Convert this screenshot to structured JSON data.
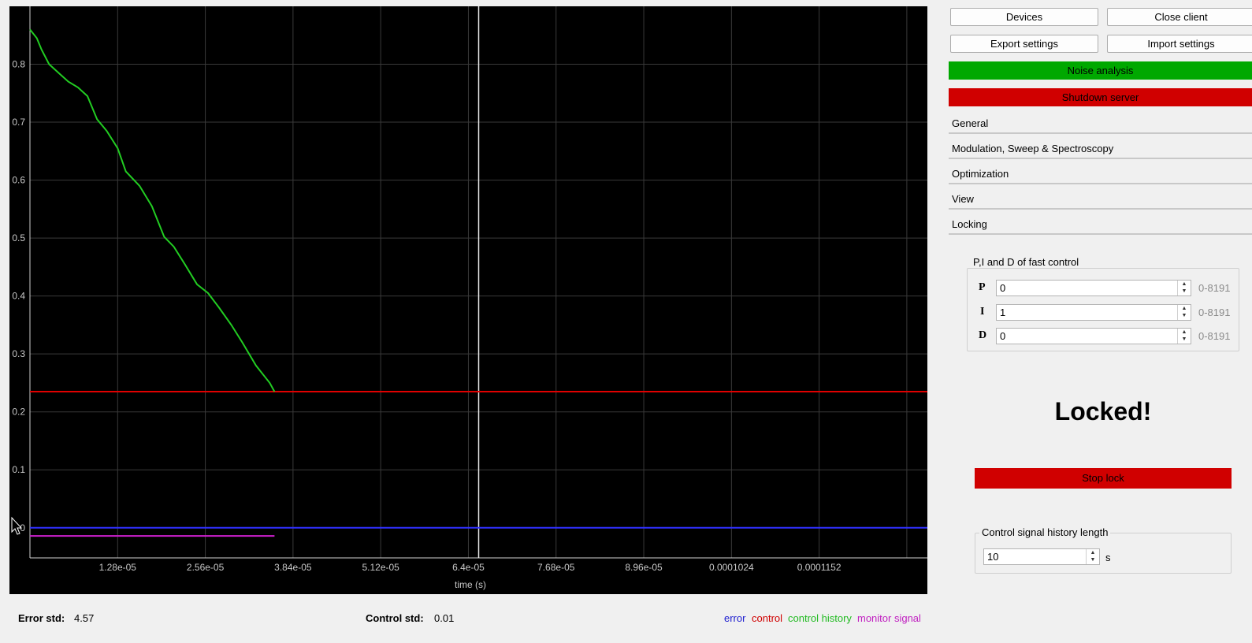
{
  "chart_data": {
    "type": "line",
    "xlabel": "time (s)",
    "x_ticks": [
      1.28e-05,
      2.56e-05,
      3.84e-05,
      5.12e-05,
      6.4e-05,
      7.68e-05,
      8.96e-05,
      0.0001024,
      0.0001152
    ],
    "x_tick_labels": [
      "1.28e-05",
      "2.56e-05",
      "3.84e-05",
      "5.12e-05",
      "6.4e-05",
      "7.68e-05",
      "8.96e-05",
      "0.0001024",
      "0.0001152"
    ],
    "xlim": [
      0,
      0.000131
    ],
    "y_ticks": [
      0,
      0.1,
      0.2,
      0.3,
      0.4,
      0.5,
      0.6,
      0.7,
      0.8
    ],
    "y_tick_labels": [
      "0",
      "0.1",
      "0.2",
      "0.3",
      "0.4",
      "0.5",
      "0.6",
      "0.7",
      "0.8"
    ],
    "ylim": [
      -0.052,
      0.9
    ],
    "grid": true,
    "cursor_x": 6.55e-05,
    "series": [
      {
        "name": "error",
        "color": "#3030ff",
        "x": [
          0,
          0.000131
        ],
        "y": [
          0.0,
          0.0
        ]
      },
      {
        "name": "control",
        "color": "#e00000",
        "x": [
          0,
          0.000131
        ],
        "y": [
          0.235,
          0.235
        ]
      },
      {
        "name": "control history",
        "color": "#22cc22",
        "x": [
          0,
          1e-06,
          1.7e-06,
          2.8e-06,
          4.2e-06,
          5.6e-06,
          7e-06,
          8.4e-06,
          9.8e-06,
          1.12e-05,
          1.28e-05,
          1.4e-05,
          1.6e-05,
          1.78e-05,
          1.96e-05,
          2.1e-05,
          2.26e-05,
          2.44e-05,
          2.6e-05,
          2.76e-05,
          2.94e-05,
          3.1e-05,
          3.3e-05,
          3.5e-05,
          3.57e-05
        ],
        "y": [
          0.86,
          0.845,
          0.825,
          0.8,
          0.785,
          0.77,
          0.76,
          0.745,
          0.705,
          0.685,
          0.655,
          0.615,
          0.59,
          0.555,
          0.502,
          0.485,
          0.455,
          0.42,
          0.405,
          0.38,
          0.35,
          0.32,
          0.28,
          0.25,
          0.235
        ]
      },
      {
        "name": "monitor signal",
        "color": "#d020d0",
        "x": [
          0,
          3.57e-05
        ],
        "y": [
          -0.014,
          -0.014
        ]
      }
    ]
  },
  "toolbar": {
    "devices": "Devices",
    "close_client": "Close client",
    "export_settings": "Export settings",
    "import_settings": "Import settings",
    "noise_analysis": "Noise analysis",
    "shutdown_server": "Shutdown server"
  },
  "colors": {
    "green_button": "#00a800",
    "red_button": "#d00000"
  },
  "sections": {
    "general": "General",
    "modulation": "Modulation, Sweep & Spectroscopy",
    "optimization": "Optimization",
    "view": "View",
    "locking": "Locking"
  },
  "pid": {
    "title": "P,I and D  of fast control",
    "p_label": "P",
    "p_value": "0",
    "p_range": "0-8191",
    "i_label": "I",
    "i_value": "1",
    "i_range": "0-8191",
    "d_label": "D",
    "d_value": "0",
    "d_range": "0-8191"
  },
  "status": {
    "locked": "Locked!",
    "stop_lock": "Stop lock"
  },
  "history": {
    "title": "Control signal history length",
    "value": "10",
    "unit": "s"
  },
  "stats": {
    "error_label": "Error std:",
    "error_value": "4.57",
    "control_label": "Control std:",
    "control_value": "0.01"
  },
  "legend": {
    "error": "error",
    "control": "control",
    "control_history": "control history",
    "monitor_signal": "monitor signal"
  },
  "icons": {
    "spin_up": "spin-up-icon",
    "spin_down": "spin-down-icon",
    "mouse_cursor": "mouse-pointer-icon"
  }
}
